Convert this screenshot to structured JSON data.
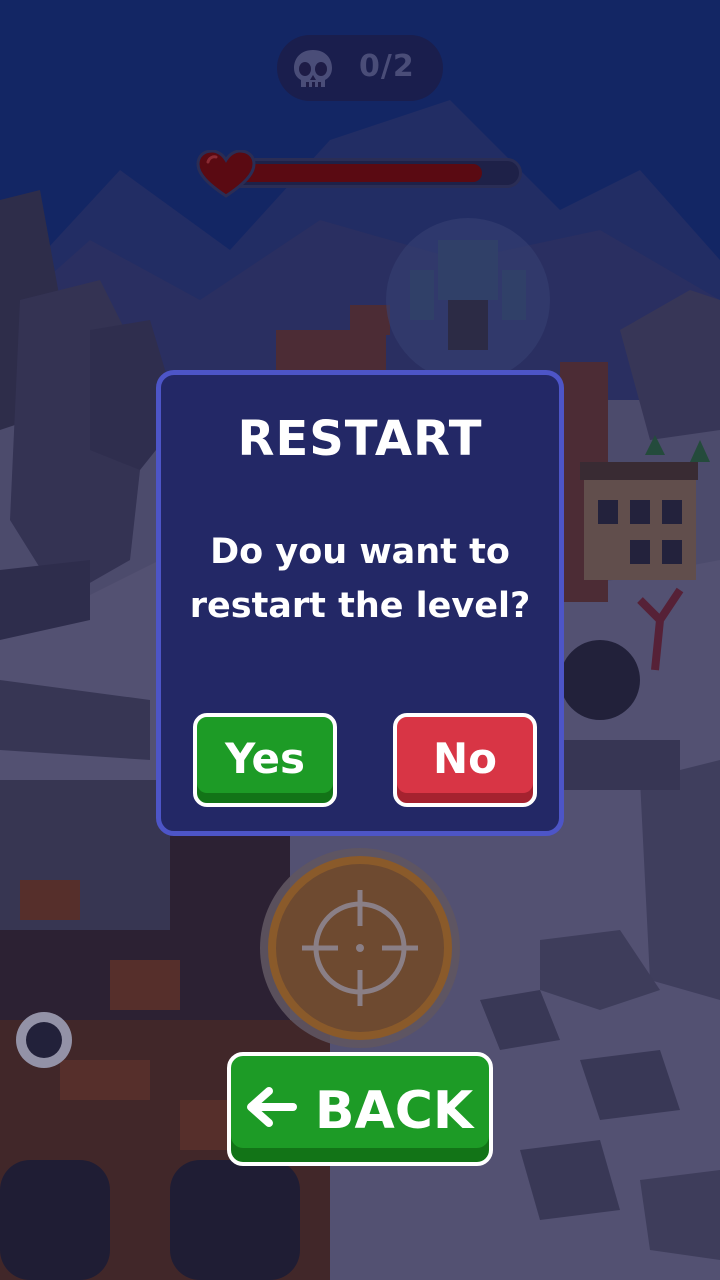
{
  "hud": {
    "kill_counter": "0/2",
    "health_fraction": 0.88
  },
  "dialog": {
    "title": "RESTART",
    "message": "Do you want to restart the level?",
    "yes_label": "Yes",
    "no_label": "No"
  },
  "back_button": {
    "label": "BACK"
  },
  "colors": {
    "sky": "#13327a",
    "dialog_bg": "#232866",
    "dialog_border": "#4d55c7",
    "yes_green": "#1d9b26",
    "no_red": "#d83545",
    "health_red": "#5a0a12"
  },
  "icons": [
    "skull-icon",
    "heart-icon",
    "crosshair-icon",
    "arrow-left-icon"
  ]
}
